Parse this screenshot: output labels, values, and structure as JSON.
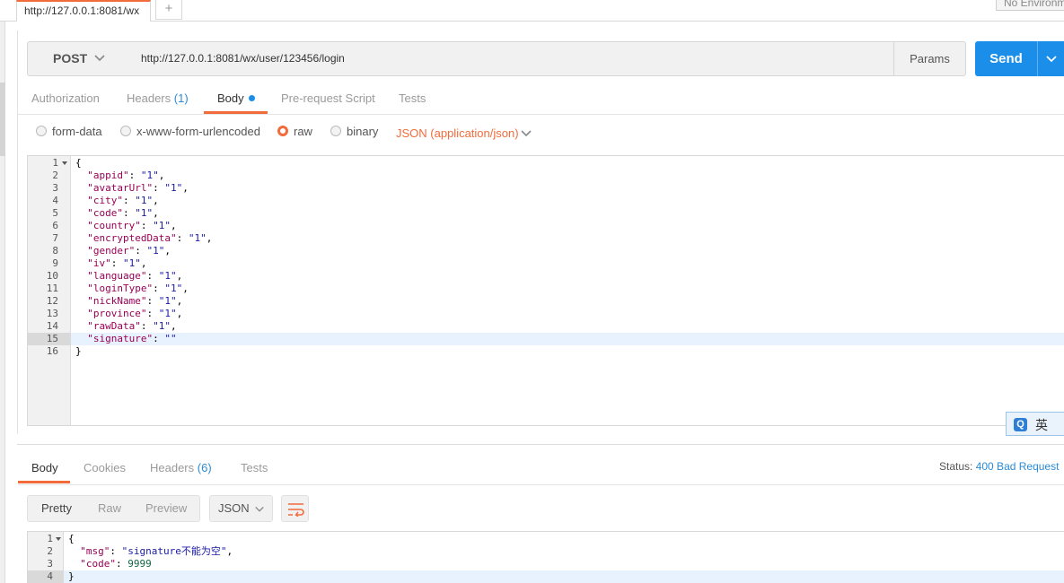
{
  "tab": {
    "title": "http://127.0.0.1:8081/wx",
    "add_symbol": "+"
  },
  "environment": {
    "label": "No Environment"
  },
  "request": {
    "method": "POST",
    "url": "http://127.0.0.1:8081/wx/user/123456/login",
    "params_label": "Params",
    "send_label": "Send",
    "tabs": [
      {
        "label": "Authorization",
        "count": ""
      },
      {
        "label": "Headers",
        "count": "(1)"
      },
      {
        "label": "Body",
        "count": "",
        "active": true
      },
      {
        "label": "Pre-request Script",
        "count": ""
      },
      {
        "label": "Tests",
        "count": ""
      }
    ],
    "body_types": [
      "form-data",
      "x-www-form-urlencoded",
      "raw",
      "binary"
    ],
    "selected_body_type": "raw",
    "content_type": "JSON (application/json)",
    "body_lines": [
      {
        "n": "1",
        "parts": [
          [
            "p",
            "{"
          ]
        ]
      },
      {
        "n": "2",
        "parts": [
          [
            "p",
            "  "
          ],
          [
            "k",
            "\"appid\""
          ],
          [
            "p",
            ": "
          ],
          [
            "s",
            "\"1\""
          ],
          [
            "p",
            ","
          ]
        ]
      },
      {
        "n": "3",
        "parts": [
          [
            "p",
            "  "
          ],
          [
            "k",
            "\"avatarUrl\""
          ],
          [
            "p",
            ": "
          ],
          [
            "s",
            "\"1\""
          ],
          [
            "p",
            ","
          ]
        ]
      },
      {
        "n": "4",
        "parts": [
          [
            "p",
            "  "
          ],
          [
            "k",
            "\"city\""
          ],
          [
            "p",
            ": "
          ],
          [
            "s",
            "\"1\""
          ],
          [
            "p",
            ","
          ]
        ]
      },
      {
        "n": "5",
        "parts": [
          [
            "p",
            "  "
          ],
          [
            "k",
            "\"code\""
          ],
          [
            "p",
            ": "
          ],
          [
            "s",
            "\"1\""
          ],
          [
            "p",
            ","
          ]
        ]
      },
      {
        "n": "6",
        "parts": [
          [
            "p",
            "  "
          ],
          [
            "k",
            "\"country\""
          ],
          [
            "p",
            ": "
          ],
          [
            "s",
            "\"1\""
          ],
          [
            "p",
            ","
          ]
        ]
      },
      {
        "n": "7",
        "parts": [
          [
            "p",
            "  "
          ],
          [
            "k",
            "\"encryptedData\""
          ],
          [
            "p",
            ": "
          ],
          [
            "s",
            "\"1\""
          ],
          [
            "p",
            ","
          ]
        ]
      },
      {
        "n": "8",
        "parts": [
          [
            "p",
            "  "
          ],
          [
            "k",
            "\"gender\""
          ],
          [
            "p",
            ": "
          ],
          [
            "s",
            "\"1\""
          ],
          [
            "p",
            ","
          ]
        ]
      },
      {
        "n": "9",
        "parts": [
          [
            "p",
            "  "
          ],
          [
            "k",
            "\"iv\""
          ],
          [
            "p",
            ": "
          ],
          [
            "s",
            "\"1\""
          ],
          [
            "p",
            ","
          ]
        ]
      },
      {
        "n": "10",
        "parts": [
          [
            "p",
            "  "
          ],
          [
            "k",
            "\"language\""
          ],
          [
            "p",
            ": "
          ],
          [
            "s",
            "\"1\""
          ],
          [
            "p",
            ","
          ]
        ]
      },
      {
        "n": "11",
        "parts": [
          [
            "p",
            "  "
          ],
          [
            "k",
            "\"loginType\""
          ],
          [
            "p",
            ": "
          ],
          [
            "s",
            "\"1\""
          ],
          [
            "p",
            ","
          ]
        ]
      },
      {
        "n": "12",
        "parts": [
          [
            "p",
            "  "
          ],
          [
            "k",
            "\"nickName\""
          ],
          [
            "p",
            ": "
          ],
          [
            "s",
            "\"1\""
          ],
          [
            "p",
            ","
          ]
        ]
      },
      {
        "n": "13",
        "parts": [
          [
            "p",
            "  "
          ],
          [
            "k",
            "\"province\""
          ],
          [
            "p",
            ": "
          ],
          [
            "s",
            "\"1\""
          ],
          [
            "p",
            ","
          ]
        ]
      },
      {
        "n": "14",
        "parts": [
          [
            "p",
            "  "
          ],
          [
            "k",
            "\"rawData\""
          ],
          [
            "p",
            ": "
          ],
          [
            "s",
            "\"1\""
          ],
          [
            "p",
            ","
          ]
        ]
      },
      {
        "n": "15",
        "parts": [
          [
            "p",
            "  "
          ],
          [
            "k",
            "\"signature\""
          ],
          [
            "p",
            ": "
          ],
          [
            "s",
            "\"\""
          ]
        ],
        "highlight": true
      },
      {
        "n": "16",
        "parts": [
          [
            "p",
            "}"
          ]
        ]
      }
    ]
  },
  "ime": {
    "logo": "Q",
    "char": "英"
  },
  "response": {
    "tabs": [
      {
        "label": "Body",
        "count": "",
        "active": true
      },
      {
        "label": "Cookies",
        "count": ""
      },
      {
        "label": "Headers",
        "count": "(6)"
      },
      {
        "label": "Tests",
        "count": ""
      }
    ],
    "status_label": "Status:",
    "status_value": "400 Bad Request",
    "formats": [
      "Pretty",
      "Raw",
      "Preview"
    ],
    "active_format": "Pretty",
    "language": "JSON",
    "body_lines": [
      {
        "n": "1",
        "parts": [
          [
            "p",
            "{"
          ]
        ]
      },
      {
        "n": "2",
        "parts": [
          [
            "p",
            "  "
          ],
          [
            "k",
            "\"msg\""
          ],
          [
            "p",
            ": "
          ],
          [
            "s",
            "\"signature不能为空\""
          ],
          [
            "p",
            ","
          ]
        ]
      },
      {
        "n": "3",
        "parts": [
          [
            "p",
            "  "
          ],
          [
            "k",
            "\"code\""
          ],
          [
            "p",
            ": "
          ],
          [
            "n",
            "9999"
          ]
        ]
      },
      {
        "n": "4",
        "parts": [
          [
            "p",
            "}"
          ]
        ],
        "highlight": true
      }
    ]
  },
  "colors": {
    "accent": "#f26b3a",
    "primary": "#1a8ee8",
    "link": "#2a8bd8"
  },
  "icons": {
    "method_caret": "chevron-down-icon",
    "send_caret": "chevron-down-icon",
    "wrap": "wrap-lines-icon",
    "fold": "fold-arrow-icon"
  }
}
